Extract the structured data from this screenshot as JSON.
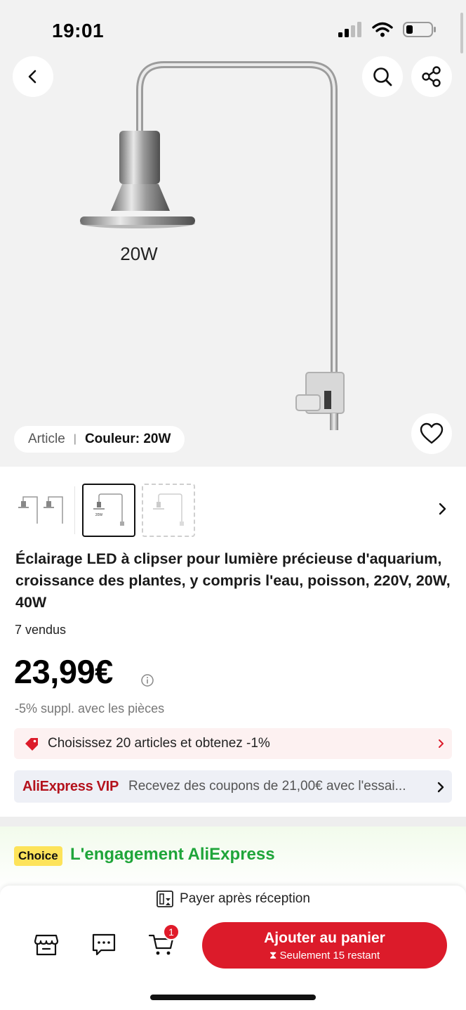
{
  "status_bar": {
    "time": "19:01"
  },
  "hero": {
    "image_label": "20W",
    "variant": {
      "label": "Article",
      "value": "Couleur: 20W"
    }
  },
  "thumbnails": [
    {
      "name": "variant-20w-40w"
    },
    {
      "name": "variant-20w",
      "selected": true,
      "label": "20W"
    },
    {
      "name": "variant-40w"
    }
  ],
  "product": {
    "title": "Éclairage LED à clipser pour lumière précieuse d'aquarium, croissance des plantes, y compris l'eau, poisson, 220V, 20W, 40W",
    "sold": "7 vendus",
    "price": "23,99€",
    "coins_note": "-5% suppl. avec les pièces"
  },
  "promo": {
    "text": "Choisissez 20 articles et obtenez -1%"
  },
  "vip": {
    "logo": "AliExpress VIP",
    "text": "Recevez des coupons de 21,00€ avec l'essai..."
  },
  "choice": {
    "badge": "Choice",
    "title": "L'engagement AliExpress"
  },
  "bottom_bar": {
    "pay_after": "Payer après réception",
    "cart_count": "1",
    "cta_label": "Ajouter au panier",
    "cta_sub": "Seulement 15 restant"
  },
  "colors": {
    "accent": "#dc1b2a",
    "choice_green": "#1fa53a",
    "choice_badge": "#fde35a",
    "promo_bg": "#fdf1f1",
    "vip_bg": "#eef0f6"
  }
}
